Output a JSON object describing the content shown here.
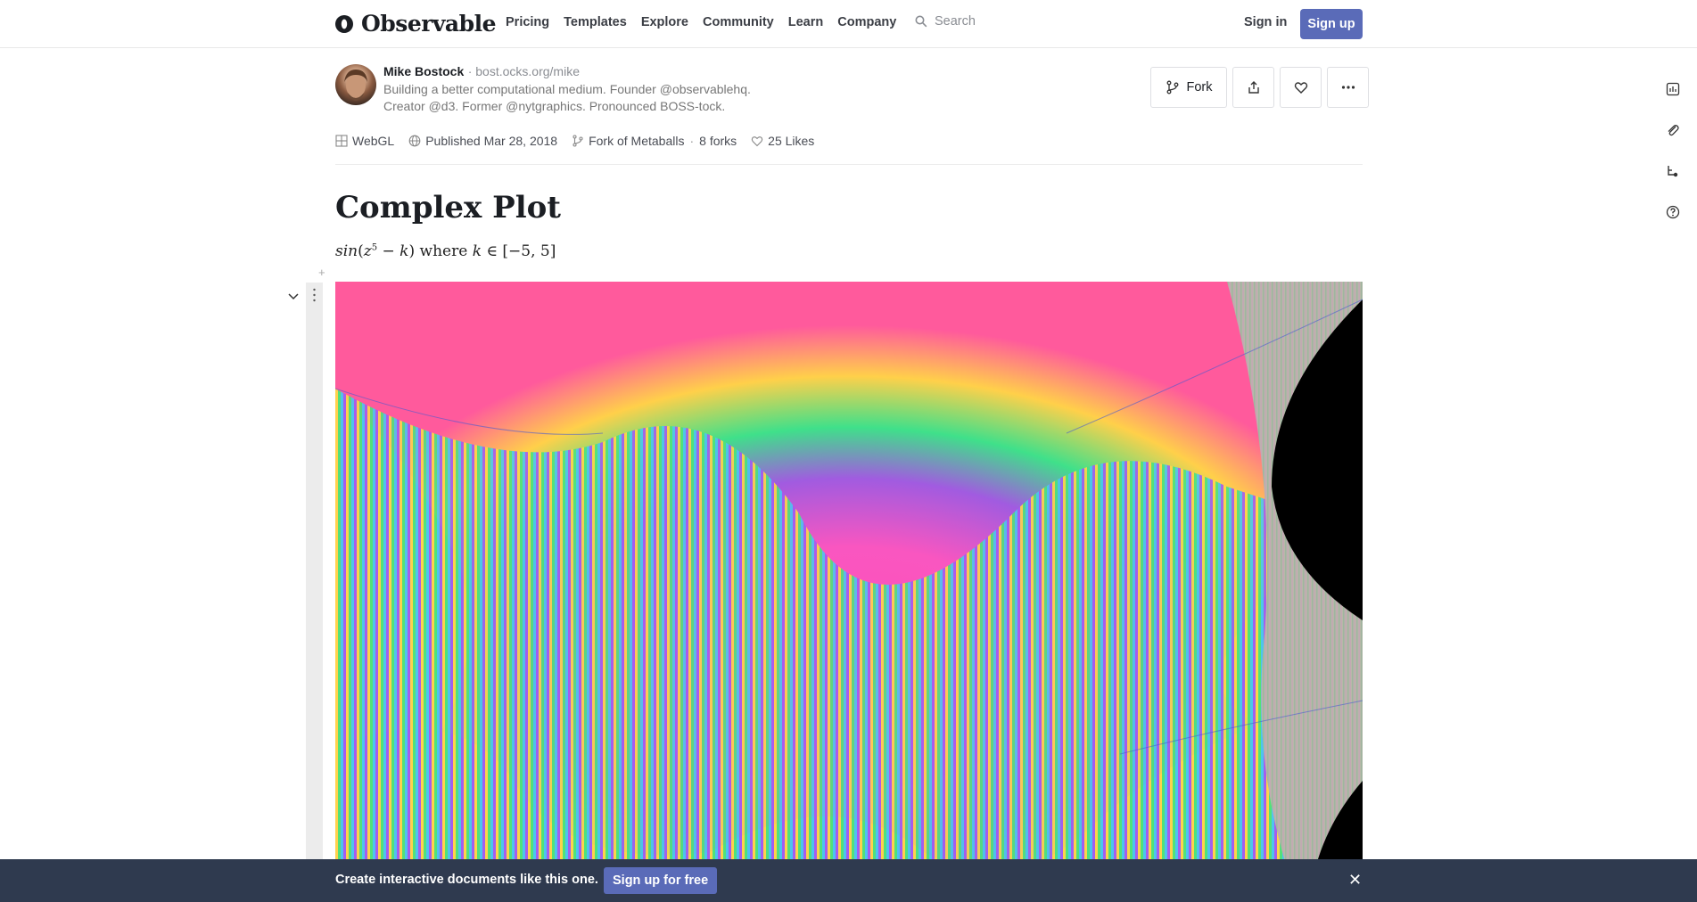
{
  "brand": {
    "name": "Observable"
  },
  "nav": {
    "items": [
      "Pricing",
      "Templates",
      "Explore",
      "Community",
      "Learn",
      "Company"
    ]
  },
  "search": {
    "placeholder": "Search"
  },
  "auth": {
    "signin": "Sign in",
    "signup": "Sign up"
  },
  "author": {
    "name": "Mike Bostock",
    "url": "bost.ocks.org/mike",
    "bio_line1": "Building a better computational medium. Founder @observablehq.",
    "bio_line2": "Creator @d3. Former @nytgraphics. Pronounced BOSS-tock."
  },
  "actions": {
    "fork": "Fork"
  },
  "meta": {
    "collection": "WebGL",
    "published": "Published Mar 28, 2018",
    "fork_of": "Fork of Metaballs",
    "forks": "8 forks",
    "likes": "25 Likes"
  },
  "notebook": {
    "title": "Complex Plot",
    "formula": {
      "fn": "sin",
      "z": "z",
      "exp": "5",
      "k": "k",
      "where": "where",
      "range": "[−5, 5]"
    }
  },
  "banner": {
    "text": "Create interactive documents like this one.",
    "cta": "Sign up for free",
    "close": "✕"
  },
  "colors": {
    "accent": "#5a6bb8",
    "banner_bg": "#2f3a4f"
  }
}
